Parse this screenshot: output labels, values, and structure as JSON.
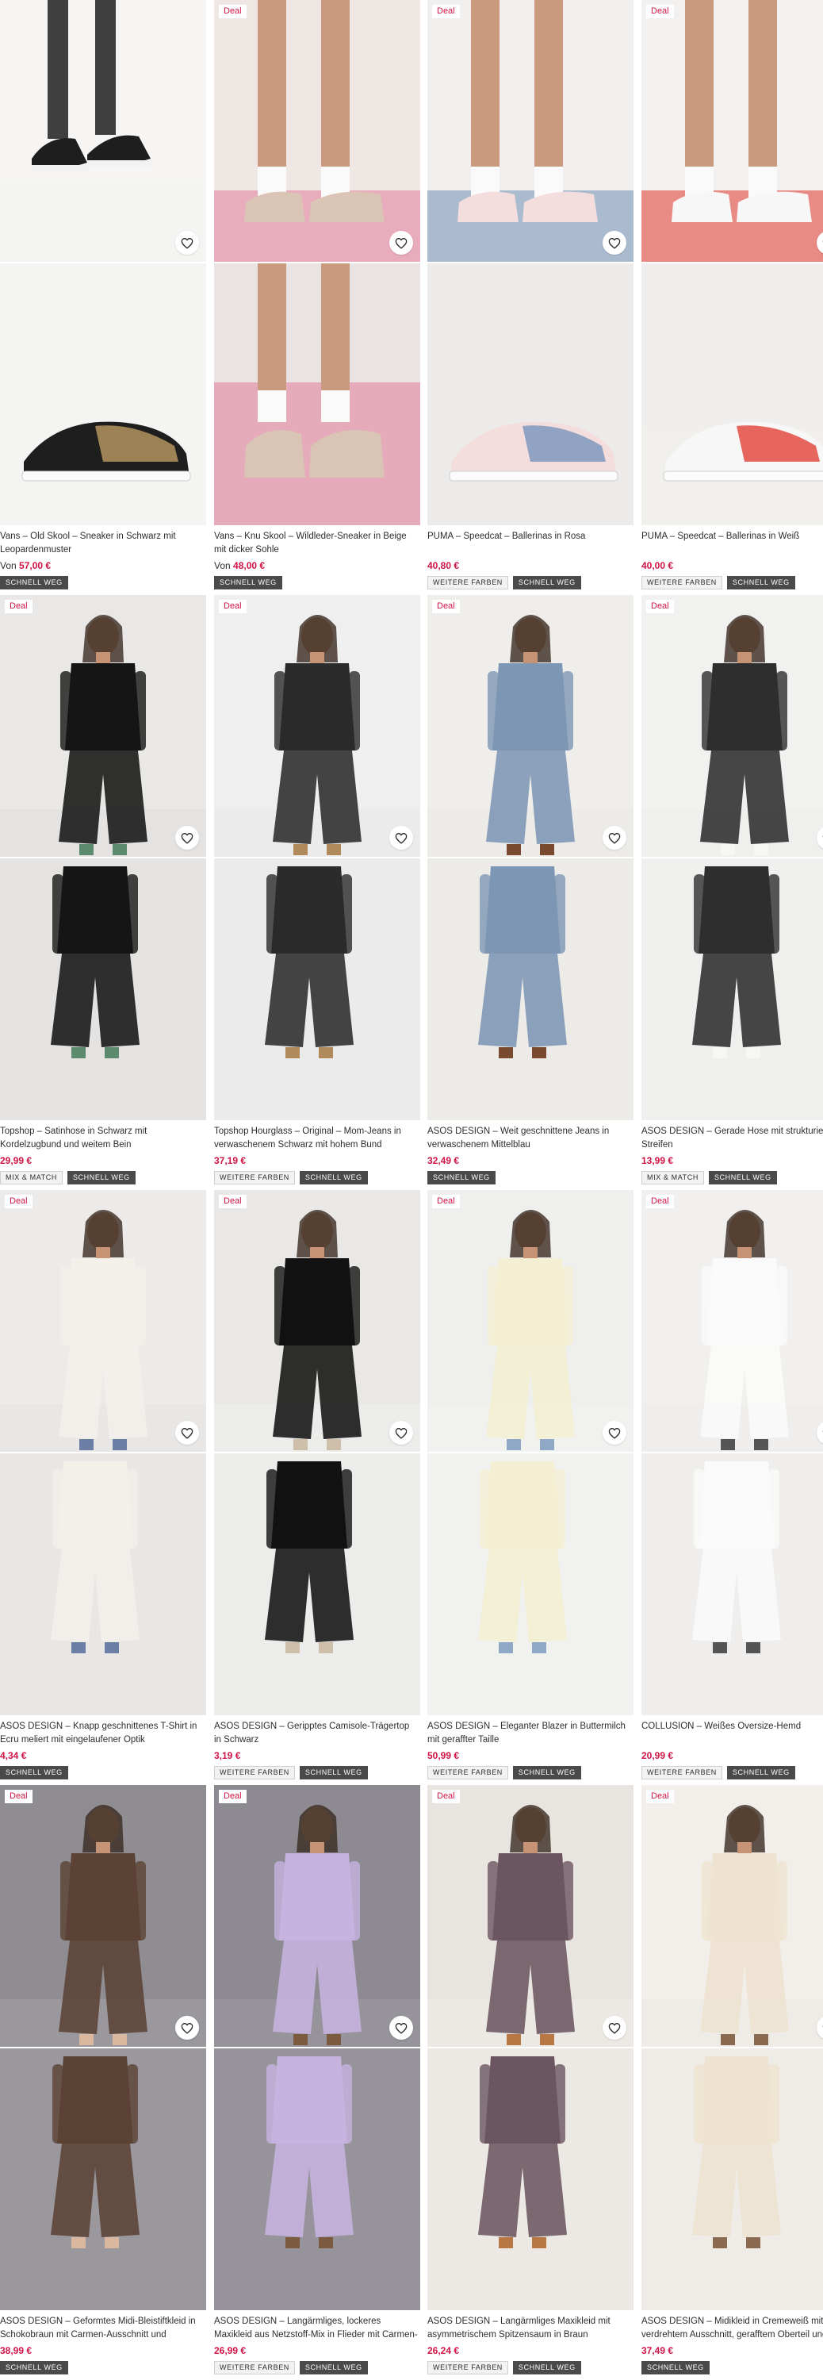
{
  "colors": {
    "accent": "#d01345",
    "text": "#2d2d2d",
    "tag_dark": "#4a4a4a"
  },
  "deal_label": "Deal",
  "products": [
    {
      "title": "Vans – Old Skool – Sneaker in Schwarz mit Leopardenmuster",
      "price_prefix": "Von",
      "price": "57,00 €",
      "deal": false,
      "tags": [
        "SCHNELL WEG"
      ],
      "palette": {
        "bg1": "#f6f5f3",
        "bg2": "#f4f4f2",
        "main": "#1e1e1e",
        "accent": "#c8a46a"
      }
    },
    {
      "title": "Vans – Knu Skool – Wildleder-Sneaker in Beige mit dicker Sohle",
      "price_prefix": "Von",
      "price": "48,00 €",
      "deal": true,
      "tags": [
        "SCHNELL WEG"
      ],
      "palette": {
        "bg1": "#efe7e4",
        "bg2": "#e9e4e1",
        "main": "#d9c4b5",
        "accent": "#e37b9b"
      }
    },
    {
      "title": "PUMA – Speedcat – Ballerinas in Rosa",
      "price_prefix": "",
      "price": "40,80 €",
      "deal": true,
      "tags": [
        "WEITERE FARBEN",
        "SCHNELL WEG"
      ],
      "palette": {
        "bg1": "#f1f0ee",
        "bg2": "#ecebea",
        "main": "#f4dedd",
        "accent": "#6f8fb8"
      }
    },
    {
      "title": "PUMA – Speedcat – Ballerinas in Weiß",
      "price_prefix": "",
      "price": "40,00 €",
      "deal": true,
      "tags": [
        "WEITERE FARBEN",
        "SCHNELL WEG"
      ],
      "palette": {
        "bg1": "#f2f1ef",
        "bg2": "#efeeec",
        "main": "#f7f7f7",
        "accent": "#e0362b"
      }
    },
    {
      "title": "Topshop – Satinhose in Schwarz mit Kordelzugbund und weitem Bein",
      "price_prefix": "",
      "price": "29,99 €",
      "deal": true,
      "tags": [
        "MIX & MATCH",
        "SCHNELL WEG"
      ],
      "palette": {
        "bg1": "#e9e8e6",
        "bg2": "#e4e3e1",
        "main": "#151515",
        "accent": "#5c8a6e"
      }
    },
    {
      "title": "Topshop Hourglass – Original – Mom-Jeans in verwaschenem Schwarz mit hohem Bund",
      "price_prefix": "",
      "price": "37,19 €",
      "deal": true,
      "tags": [
        "WEITERE FARBEN",
        "SCHNELL WEG"
      ],
      "palette": {
        "bg1": "#efefef",
        "bg2": "#ebebeb",
        "main": "#2b2b2b",
        "accent": "#b08a5a"
      }
    },
    {
      "title": "ASOS DESIGN – Weit geschnittene Jeans in verwaschenem Mittelblau",
      "price_prefix": "",
      "price": "32,49 €",
      "deal": true,
      "tags": [
        "SCHNELL WEG"
      ],
      "palette": {
        "bg1": "#f0eeeb",
        "bg2": "#ecebe8",
        "main": "#7d96b4",
        "accent": "#7a4a2e"
      }
    },
    {
      "title": "ASOS DESIGN – Gerade Hose mit strukturierten Streifen",
      "price_prefix": "",
      "price": "13,99 €",
      "deal": true,
      "tags": [
        "MIX & MATCH",
        "SCHNELL WEG"
      ],
      "palette": {
        "bg1": "#f1f1f0",
        "bg2": "#efefee",
        "main": "#2e2e2e",
        "accent": "#f6f6f4"
      }
    },
    {
      "title": "ASOS DESIGN – Knapp geschnittenes T-Shirt in Ecru meliert mit eingelaufener Optik",
      "price_prefix": "",
      "price": "4,34 €",
      "deal": true,
      "tags": [
        "SCHNELL WEG"
      ],
      "palette": {
        "bg1": "#ecebe9",
        "bg2": "#e8e7e5",
        "main": "#f3f0ea",
        "accent": "#6a7fa3"
      }
    },
    {
      "title": "ASOS DESIGN – Geripptes Camisole-Trägertop in Schwarz",
      "price_prefix": "",
      "price": "3,19 €",
      "deal": true,
      "tags": [
        "WEITERE FARBEN",
        "SCHNELL WEG"
      ],
      "palette": {
        "bg1": "#e9e8e6",
        "bg2": "#ececea",
        "main": "#121212",
        "accent": "#cdbfa9"
      }
    },
    {
      "title": "ASOS DESIGN – Eleganter Blazer in Buttermilch mit geraffter Taille",
      "price_prefix": "",
      "price": "50,99 €",
      "deal": true,
      "tags": [
        "WEITERE FARBEN",
        "SCHNELL WEG"
      ],
      "palette": {
        "bg1": "#efefed",
        "bg2": "#f1f1ef",
        "main": "#f4efd2",
        "accent": "#8fa8c6"
      }
    },
    {
      "title": "COLLUSION – Weißes Oversize-Hemd",
      "price_prefix": "",
      "price": "20,99 €",
      "deal": true,
      "tags": [
        "WEITERE FARBEN",
        "SCHNELL WEG"
      ],
      "palette": {
        "bg1": "#f1f0ee",
        "bg2": "#efeeec",
        "main": "#fafafa",
        "accent": "#555555"
      }
    },
    {
      "title": "ASOS DESIGN – Geformtes Midi-Bleistiftkleid in Schokobraun mit Carmen-Ausschnitt und Ziernähten",
      "price_prefix": "",
      "price": "38,99 €",
      "deal": true,
      "tags": [
        "SCHNELL WEG"
      ],
      "palette": {
        "bg1": "#8f8d92",
        "bg2": "#9a989d",
        "main": "#5b4235",
        "accent": "#d9b89f"
      }
    },
    {
      "title": "ASOS DESIGN – Langärmliges, lockeres Maxikleid aus Netzstoff-Mix in Flieder mit Carmen-Ausschnitt",
      "price_prefix": "",
      "price": "26,99 €",
      "deal": true,
      "tags": [
        "WEITERE FARBEN",
        "SCHNELL WEG"
      ],
      "palette": {
        "bg1": "#8d8b91",
        "bg2": "#96949a",
        "main": "#c7b3e0",
        "accent": "#7c5a3f"
      }
    },
    {
      "title": "ASOS DESIGN – Langärmliges Maxikleid mit asymmetrischem Spitzensaum in Braun",
      "price_prefix": "",
      "price": "26,24 €",
      "deal": true,
      "tags": [
        "WEITERE FARBEN",
        "SCHNELL WEG"
      ],
      "palette": {
        "bg1": "#e8e4df",
        "bg2": "#ece8e3",
        "main": "#6b5560",
        "accent": "#b87843"
      }
    },
    {
      "title": "ASOS DESIGN – Midikleid in Cremeweiß mit verdrehtem Ausschnitt, gerafftem Oberteil und Schlitz",
      "price_prefix": "",
      "price": "37,49 €",
      "deal": true,
      "tags": [
        "SCHNELL WEG"
      ],
      "palette": {
        "bg1": "#f2efeb",
        "bg2": "#efece8",
        "main": "#eee3d0",
        "accent": "#8a6a50"
      }
    }
  ]
}
